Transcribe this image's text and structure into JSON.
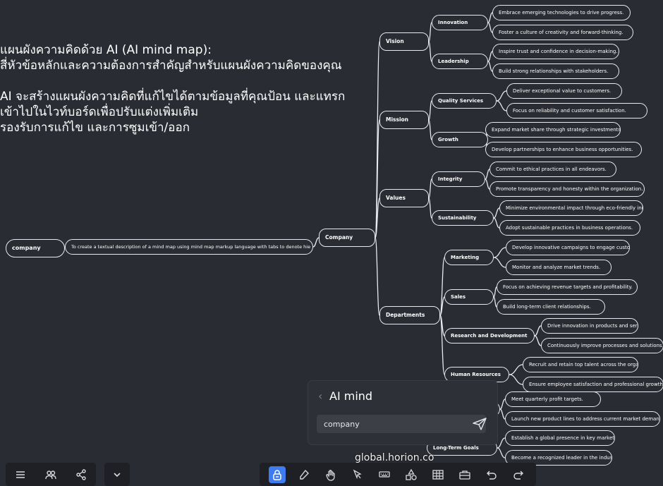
{
  "intro": {
    "lines": [
      "แผนผังความคิดด้วย AI (AI mind map):",
      "สี่หัวข้อหลักและความต้องการสำคัญสำหรับแผนผังความคิดของคุณ",
      "",
      "AI จะสร้างแผนผังความคิดที่แก้ไขได้ตามข้อมูลที่คุณป้อน และแทรก",
      "เข้าไปในไวท์บอร์ดเพื่อปรับแต่งเพิ่มเติม",
      "รองรับการแก้ไข และการซูมเข้า/ออก"
    ]
  },
  "mindmap": {
    "root": "company",
    "description": "To create a textual description of a mind map using mind map markup language with tabs to denote hie",
    "company": "Company",
    "sections": [
      {
        "name": "Vision",
        "groups": [
          {
            "name": "Innovation",
            "items": [
              "Embrace emerging technologies to drive progress.",
              "Foster a culture of creativity and forward-thinking."
            ]
          },
          {
            "name": "Leadership",
            "items": [
              "Inspire trust and confidence in decision-making.",
              "Build strong relationships with stakeholders."
            ]
          }
        ]
      },
      {
        "name": "Mission",
        "groups": [
          {
            "name": "Quality Services",
            "items": [
              "Deliver exceptional value to customers.",
              "Focus on reliability and customer satisfaction."
            ]
          },
          {
            "name": "Growth",
            "items": [
              "Expand market share through strategic investments.",
              "Develop partnerships to enhance business opportunities."
            ]
          }
        ]
      },
      {
        "name": "Values",
        "groups": [
          {
            "name": "Integrity",
            "items": [
              "Commit to ethical practices in all endeavors.",
              "Promote transparency and honesty within the organization."
            ]
          },
          {
            "name": "Sustainability",
            "items": [
              "Minimize environmental impact through eco-friendly initiatives.",
              "Adopt sustainable practices in business operations."
            ]
          }
        ]
      },
      {
        "name": "Departments",
        "groups": [
          {
            "name": "Marketing",
            "items": [
              "Develop innovative campaigns to engage customers.",
              "Monitor and analyze market trends."
            ]
          },
          {
            "name": "Sales",
            "items": [
              "Focus on achieving revenue targets and profitability.",
              "Build long-term client relationships."
            ]
          },
          {
            "name": "Research and Development",
            "items": [
              "Drive innovation in products and services.",
              "Continuously improve processes and solutions."
            ]
          },
          {
            "name": "Human Resources",
            "items": [
              "Recruit and retain top talent across the organization.",
              "Ensure employee satisfaction and professional growth."
            ]
          }
        ]
      },
      {
        "name": "",
        "groups": [
          {
            "name": "",
            "items": [
              "Meet quarterly profit targets.",
              "Launch new product lines to address current market demands."
            ]
          },
          {
            "name": "Long-Term Goals",
            "items": [
              "Establish a global presence in key markets.",
              "Become a recognized leader in the industry."
            ]
          }
        ]
      }
    ]
  },
  "ai_panel": {
    "title": "AI mind",
    "input_value": "company"
  },
  "watermark": "global.horion.co",
  "icons": {
    "left_toolbar": [
      "menu-icon",
      "users-icon",
      "share-icon"
    ],
    "collapse": "chevron-down-icon",
    "tools": [
      "lock-icon",
      "eraser-icon",
      "hand-pointer-icon",
      "select-icon",
      "keyboard-icon",
      "shapes-icon",
      "table-icon",
      "briefcase-icon",
      "undo-icon",
      "redo-icon"
    ]
  },
  "colors": {
    "background": "#2a2c33",
    "line": "#e9e9ee",
    "accent": "#3f7cf0"
  }
}
